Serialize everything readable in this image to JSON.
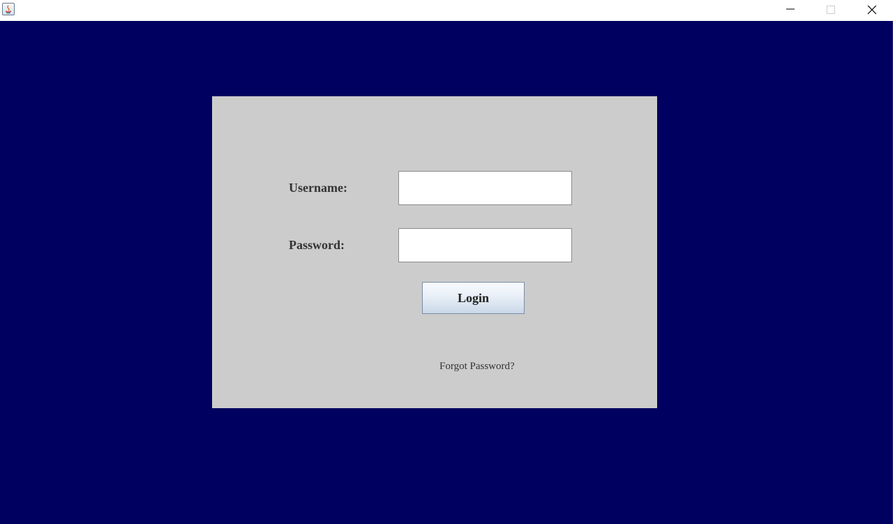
{
  "window": {
    "title": "",
    "controls": [
      "minimize-icon",
      "maximize-icon",
      "close-icon"
    ]
  },
  "colors": {
    "background": "#000060",
    "panel": "#cccccc",
    "label_text": "#333333"
  },
  "form": {
    "username_label": "Username:",
    "username_value": "",
    "password_label": "Password:",
    "password_value": "",
    "login_label": "Login",
    "forgot_label": "Forgot Password?"
  }
}
